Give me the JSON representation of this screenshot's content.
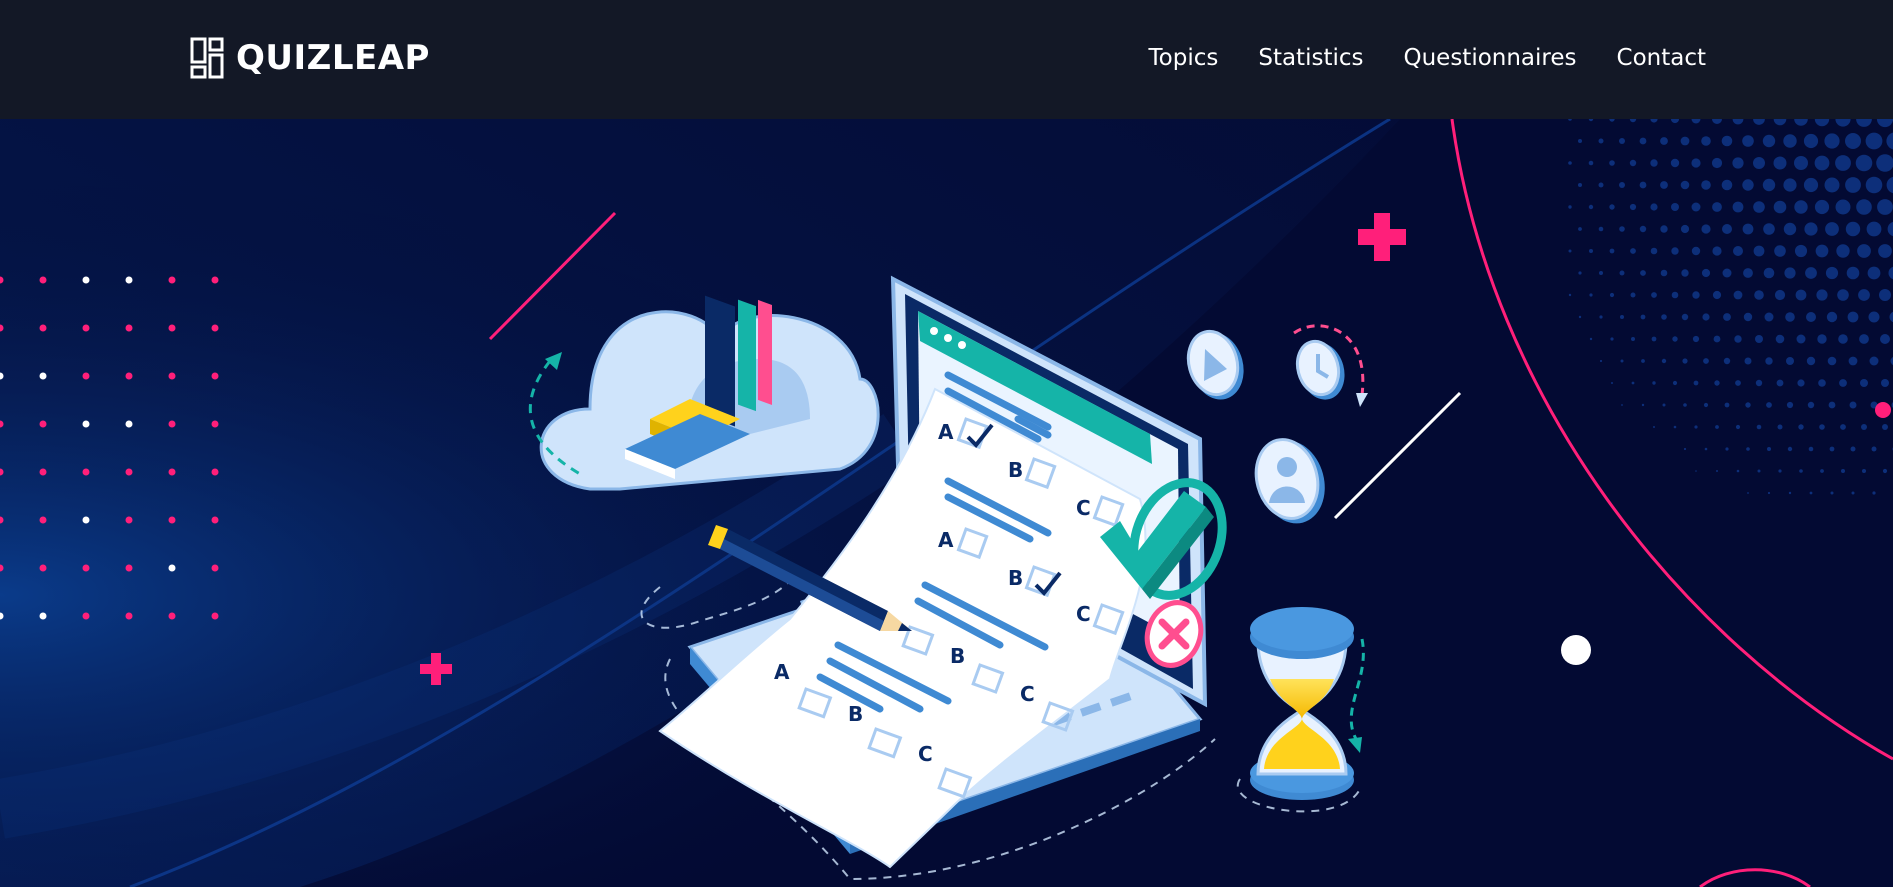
{
  "header": {
    "brand": {
      "name": "QUIZLEAP",
      "icon": "grid-logo-icon"
    },
    "nav": [
      {
        "label": "Topics"
      },
      {
        "label": "Statistics"
      },
      {
        "label": "Questionnaires"
      },
      {
        "label": "Contact"
      }
    ]
  },
  "hero": {
    "quiz_options": [
      "A",
      "B",
      "C"
    ],
    "icons": [
      "cloud-bookshelf-icon",
      "laptop-quiz-icon",
      "pencil-icon",
      "check-mark-icon",
      "cross-mark-icon",
      "play-icon",
      "clock-icon",
      "user-icon",
      "hourglass-icon",
      "plus-icon",
      "dot-grid-icon"
    ]
  },
  "colors": {
    "navbar_bg": "#131826",
    "hero_bg": "#030a33",
    "accent_pink": "#ff1f7a",
    "accent_teal": "#15b4a8",
    "light_blue": "#cfe4fb",
    "mid_blue": "#3f8ad3",
    "navy": "#0a2a66",
    "yellow": "#ffd21c"
  }
}
